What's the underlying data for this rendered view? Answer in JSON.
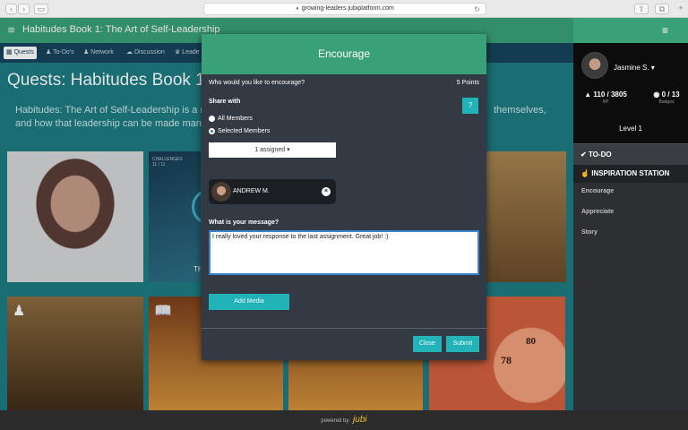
{
  "browser": {
    "url": "growing-leaders.jubiplatform.com",
    "back_glyph": "‹",
    "forward_glyph": "›",
    "sidebar_glyph": "▭",
    "reload_glyph": "↻",
    "share_glyph": "⇧",
    "tabs_glyph": "⧉",
    "newtab_glyph": "+",
    "lock_icon": "lock-icon"
  },
  "header": {
    "title": "Habitudes Book 1: The Art of Self-Leadership",
    "logo_icon": "≋",
    "menu_icon": "≡"
  },
  "nav": {
    "tabs": [
      {
        "label": "Quests",
        "icon": "▦"
      },
      {
        "label": "To-Do's",
        "icon": "♟"
      },
      {
        "label": "Network",
        "icon": "♟"
      },
      {
        "label": "Discussion",
        "icon": "☁"
      },
      {
        "label": "Leade",
        "icon": "♛"
      }
    ]
  },
  "page": {
    "title": "Quests: Habitudes Book 1",
    "desc_line1": "Habitudes: The Art of Self-Leadership is a re",
    "desc_line2": "and how that leadership can be made manife",
    "desc_right": "themselves,"
  },
  "tiles": {
    "challenges_label": "CHALLENGES",
    "challenges_count": "11 / 11",
    "tile_letter": "TH",
    "gauge_80": "80",
    "gauge_78": "78"
  },
  "sidebar": {
    "user_name": "Jasmine S. ▾",
    "xp_value": "110 / 3805",
    "xp_label": "XP",
    "badges_value": "0 / 13",
    "badges_label": "Badges",
    "level": "Level 1",
    "todo": "TO-DO",
    "inspiration": "INSPIRATION STATION",
    "items": [
      "Encourage",
      "Appreciate",
      "Story"
    ]
  },
  "modal": {
    "title": "Encourage",
    "question": "Who would you like to encourage?",
    "points": "5 Points",
    "help": "?",
    "share_with": "Share with",
    "opt_all": "All Members",
    "opt_selected": "Selected Members",
    "assigned": "1 assigned ▾",
    "member_name": "ANDREW M.",
    "message_label": "What is your message?",
    "message_text": "I really loved your response to the last assignment. Great job! :)",
    "add_media": "Add Media",
    "close": "Close",
    "submit": "Submit"
  },
  "footer": {
    "powered_by": "powered by:",
    "brand": "jubi"
  },
  "colors": {
    "accent_green": "#3aa078",
    "teal_button": "#22b3b8",
    "nav_bg": "#15425a",
    "modal_bg": "#343a43",
    "sidebar_bg": "#2d2f33"
  }
}
